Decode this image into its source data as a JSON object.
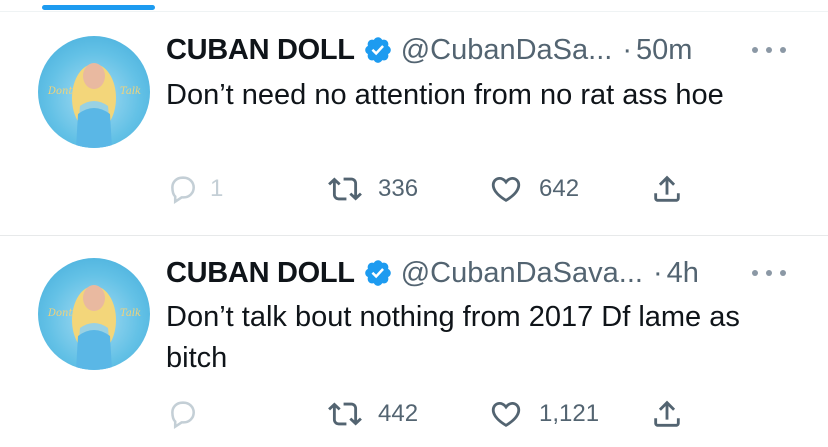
{
  "tweets": [
    {
      "name": "CUBAN DOLL",
      "handle": "@CubanDaSa...",
      "dot": "·",
      "time": "50m",
      "text": "Don’t need no attention from no rat ass hoe",
      "replies": "1",
      "retweets": "336",
      "likes": "642"
    },
    {
      "name": "CUBAN DOLL",
      "handle": "@CubanDaSava...",
      "dot": "·",
      "time": "4h",
      "text": "Don’t talk bout nothing from 2017 Df lame as bitch",
      "replies": "",
      "retweets": "442",
      "likes": "1,121"
    }
  ],
  "avatar": {
    "text_left": "Dont",
    "text_right": "Talk"
  },
  "icons": {
    "verified": "verified-badge-icon",
    "reply": "reply-icon",
    "retweet": "retweet-icon",
    "like": "heart-icon",
    "share": "share-icon",
    "more": "more-icon"
  },
  "colors": {
    "accent": "#1d9bf0",
    "secondary_text": "#536471",
    "icon": "#536471"
  }
}
